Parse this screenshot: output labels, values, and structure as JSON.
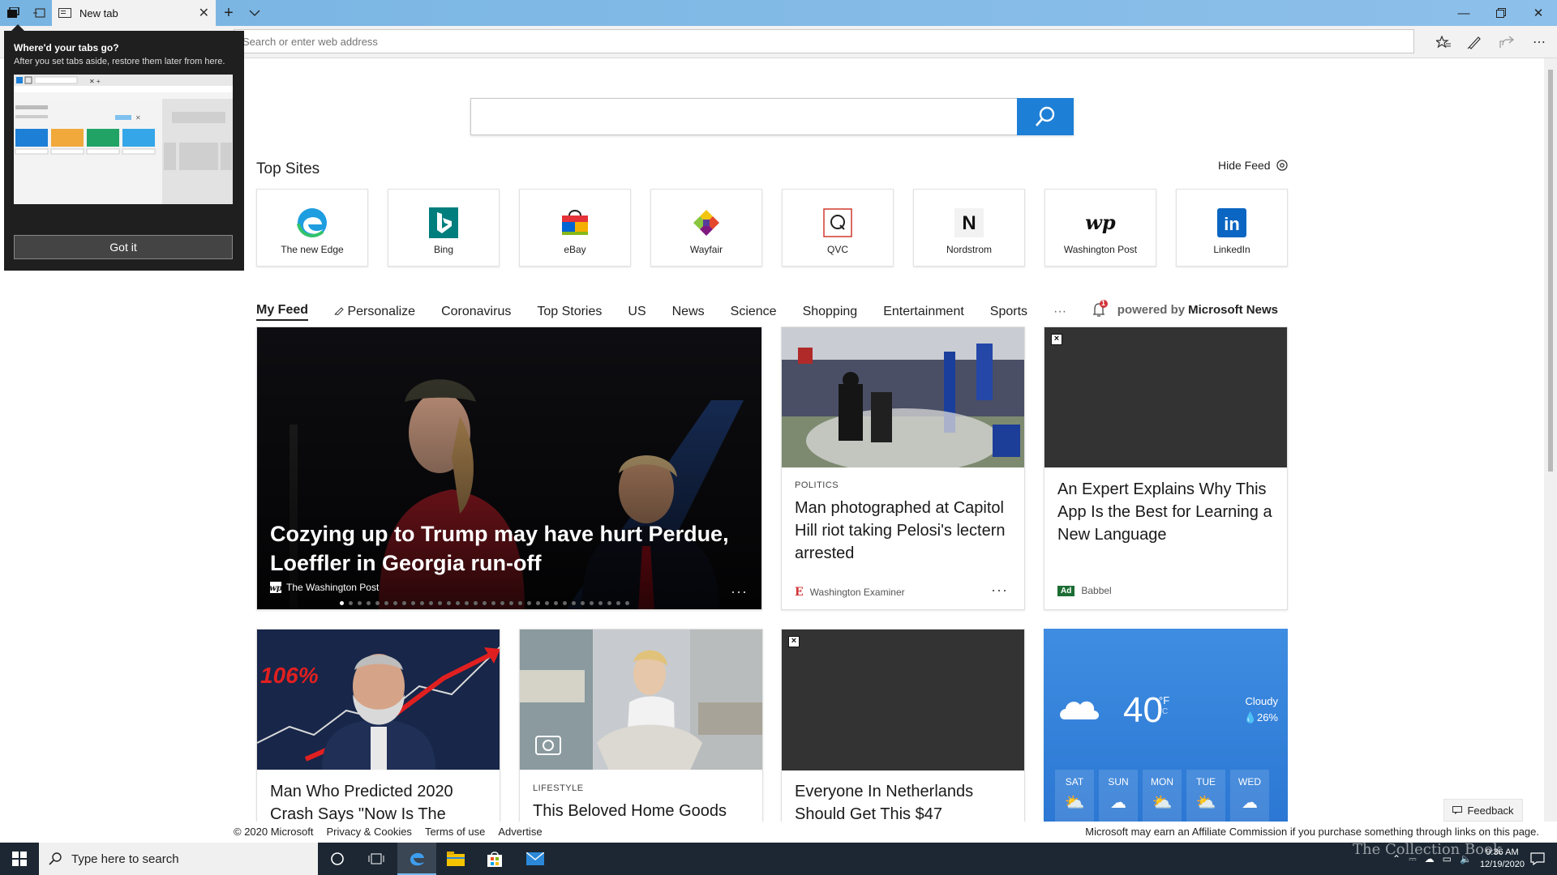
{
  "browser": {
    "tab_title": "New tab",
    "address_placeholder": "Search or enter web address"
  },
  "popup": {
    "title": "Where'd your tabs go?",
    "body": "After you set tabs aside, restore them later from here.",
    "button": "Got it"
  },
  "top_sites": {
    "title": "Top Sites",
    "hide_feed": "Hide Feed",
    "items": [
      {
        "label": "The new Edge"
      },
      {
        "label": "Bing"
      },
      {
        "label": "eBay"
      },
      {
        "label": "Wayfair"
      },
      {
        "label": "QVC"
      },
      {
        "label": "Nordstrom"
      },
      {
        "label": "Washington Post"
      },
      {
        "label": "LinkedIn"
      }
    ]
  },
  "feed_nav": {
    "items": [
      "My Feed",
      "Personalize",
      "Coronavirus",
      "Top Stories",
      "US",
      "News",
      "Science",
      "Shopping",
      "Entertainment",
      "Sports",
      "···"
    ],
    "notification_count": "1",
    "powered_prefix": "powered by",
    "powered_brand": "Microsoft News"
  },
  "cards": {
    "hero": {
      "title": "Cozying up to Trump may have hurt Perdue, Loeffler in Georgia run-off",
      "source": "The Washington Post",
      "more": "···"
    },
    "politics": {
      "category": "POLITICS",
      "title": "Man photographed at Capitol Hill riot taking Pelosi's lectern arrested",
      "source": "Washington Examiner",
      "more": "···"
    },
    "ad_babbel": {
      "title": "An Expert Explains Why This App Is the Best for Learning a New Language",
      "badge": "Ad",
      "source": "Babbel"
    },
    "crash": {
      "title": "Man Who Predicted 2020 Crash Says \"Now Is The",
      "img_text": "106%"
    },
    "lifestyle": {
      "category": "LIFESTYLE",
      "title": "This Beloved Home Goods"
    },
    "netherlands": {
      "title": "Everyone In Netherlands Should Get This $47"
    },
    "weather": {
      "temp": "40",
      "unit_f": "°F",
      "unit_c": "°C",
      "condition": "Cloudy",
      "precip": "26%",
      "days": [
        "SAT",
        "SUN",
        "MON",
        "TUE",
        "WED"
      ]
    }
  },
  "footer": {
    "links": [
      "© 2020 Microsoft",
      "Privacy & Cookies",
      "Terms of use",
      "Advertise"
    ],
    "affiliate": "Microsoft may earn an Affiliate Commission if you purchase something through links on this page.",
    "feedback": "Feedback"
  },
  "taskbar": {
    "search_placeholder": "Type here to search",
    "time": "9:36 AM",
    "date": "12/19/2020",
    "watermark": "The Collection Book"
  },
  "colors": {
    "edge_blue": "#1e7fd6",
    "tabbar": "#78b4e2",
    "taskbar": "#1c2733",
    "weather": "#2b77d3",
    "ad_green": "#1c6d34"
  }
}
